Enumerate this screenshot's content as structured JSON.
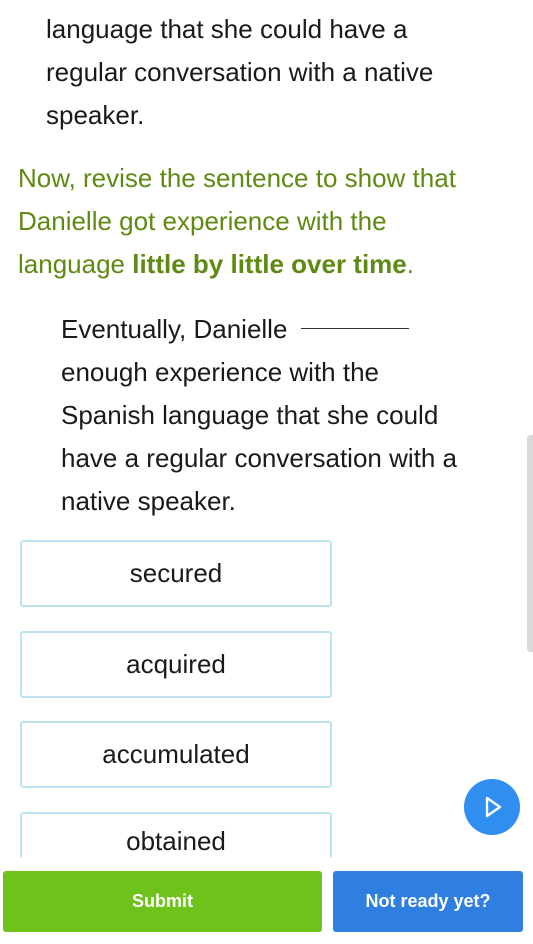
{
  "passage": {
    "fragment_lines": [
      "language that she could have a",
      "regular conversation with a native",
      "speaker."
    ]
  },
  "instruction": {
    "line1": "Now, revise the sentence to show that",
    "line2": "Danielle got experience with the",
    "line3_prefix": "language ",
    "line3_bold": "little by little over time",
    "line3_suffix": "."
  },
  "sentence": {
    "before_blank": "Eventually, Danielle",
    "after_blank_lines": [
      "enough experience with the",
      "Spanish language that she could",
      "have a regular conversation with a",
      "native speaker."
    ]
  },
  "choices": [
    {
      "label": "secured"
    },
    {
      "label": "acquired"
    },
    {
      "label": "accumulated"
    },
    {
      "label": "obtained"
    }
  ],
  "audio": {
    "icon": "play-icon",
    "color": "#2f8ef0"
  },
  "footer": {
    "submit_label": "Submit",
    "not_ready_label": "Not ready yet?",
    "submit_color": "#6fc11b",
    "not_ready_color": "#2f7fe0"
  }
}
